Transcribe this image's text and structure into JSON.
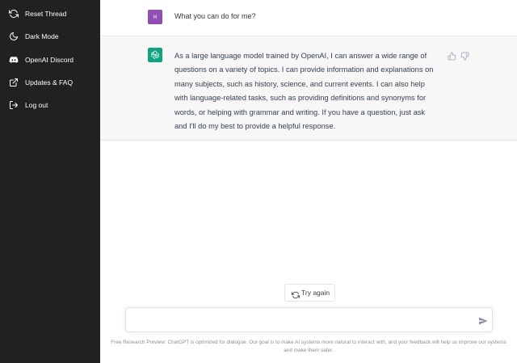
{
  "sidebar": {
    "items": [
      {
        "label": "Reset Thread",
        "icon": "refresh-icon"
      },
      {
        "label": "Dark Mode",
        "icon": "moon-icon"
      },
      {
        "label": "OpenAI Discord",
        "icon": "discord-icon"
      },
      {
        "label": "Updates & FAQ",
        "icon": "external-link-icon"
      },
      {
        "label": "Log out",
        "icon": "logout-icon"
      }
    ]
  },
  "conversation": {
    "user_avatar_initials": "M",
    "user_message": "What you can do for me?",
    "assistant_message": "As a large language model trained by OpenAI, I can answer a wide range of questions on a variety of topics. I can provide information and explanations on many subjects, such as history, science, and current events. I can also help with language-related tasks, such as providing definitions and synonyms for words, or helping with grammar and writing. If you have a question, just ask and I'll do my best to provide a helpful response."
  },
  "actions": {
    "try_again_label": "Try again"
  },
  "composer": {
    "value": "",
    "placeholder": ""
  },
  "footer": {
    "disclaimer": "Free Research Preview: ChatGPT is optimized for dialogue. Our goal is to make AI systems more natural to interact with, and your feedback will help us improve our systems and make them safer."
  },
  "colors": {
    "sidebar_bg": "#202123",
    "assistant_row_bg": "#f7f7f8",
    "user_avatar": "#8e4fb0",
    "assistant_avatar": "#10a37f"
  }
}
